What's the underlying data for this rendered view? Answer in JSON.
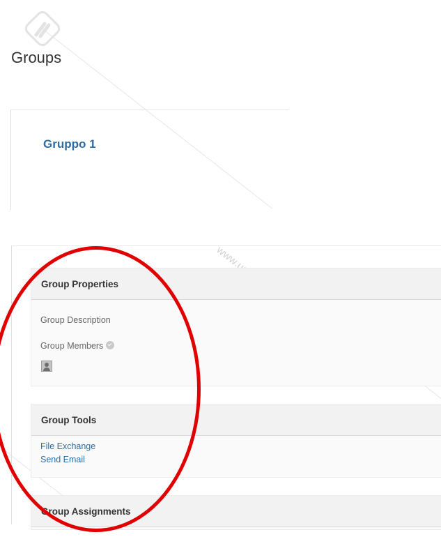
{
  "page": {
    "title": "Groups"
  },
  "group": {
    "name": "Gruppo 1"
  },
  "watermark": {
    "text": "www.unidocs.it",
    "icon": "unidocs-logo-icon"
  },
  "properties": {
    "heading": "Group Properties",
    "description_label": "Group Description",
    "members_label": "Group Members",
    "members_icon": "info-icon",
    "member_avatar": "avatar-icon"
  },
  "tools": {
    "heading": "Group Tools",
    "links": [
      "File Exchange",
      "Send Email"
    ]
  },
  "assignments": {
    "heading": "Group Assignments"
  },
  "annotation": {
    "shape": "ellipse",
    "color": "#e00000"
  },
  "colors": {
    "link": "#2e6da4",
    "section_bg": "#fafafa",
    "header_bg": "#f2f2f2"
  }
}
